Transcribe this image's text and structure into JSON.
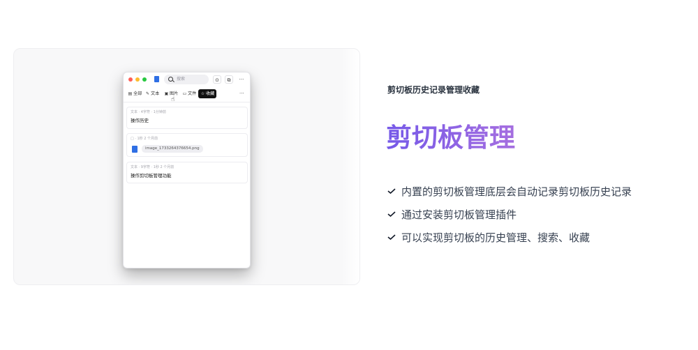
{
  "app": {
    "search_placeholder": "搜索",
    "toolbar_icons": [
      "pin-icon",
      "copy-icon",
      "more-icon"
    ],
    "filters": [
      {
        "label": "全部",
        "icon": "list-icon"
      },
      {
        "label": "文本",
        "icon": "pencil-icon"
      },
      {
        "label": "图片",
        "icon": "image-icon"
      },
      {
        "label": "文件",
        "icon": "file-icon"
      },
      {
        "label": "收藏",
        "icon": "star-icon",
        "active": true
      }
    ],
    "more_label": "···",
    "cards": [
      {
        "meta": "文本 · 4字符 · 1分钟前",
        "content": "操作历史"
      },
      {
        "meta": "□ · 1秒 2 个月前",
        "file": "image_1733264376654.png"
      },
      {
        "meta": "文本 · 9字符 · 1秒 2 个月前",
        "content": "操作剪切板管理功能"
      }
    ]
  },
  "copy": {
    "subtitle": "剪切板历史记录管理收藏",
    "headline": "剪切板管理",
    "features": [
      "内置的剪切板管理底层会自动记录剪切板历史记录",
      "通过安装剪切板管理插件",
      "可以实现剪切板的历史管理、搜索、收藏"
    ]
  },
  "colors": {
    "headline_gradient": [
      "#7559e8",
      "#a56ee0"
    ],
    "active_filter_bg": "#111111"
  }
}
